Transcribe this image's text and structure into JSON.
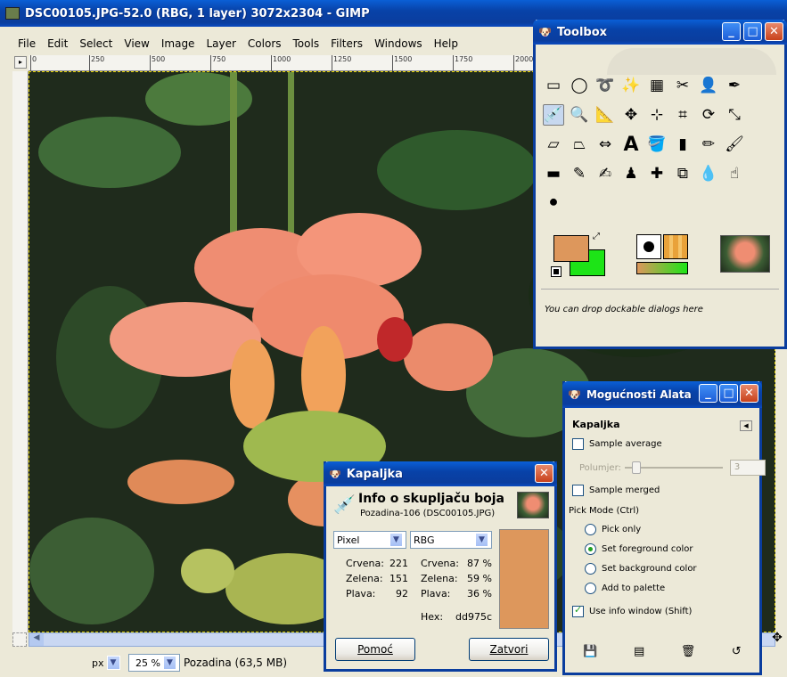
{
  "main_window": {
    "title": "DSC00105.JPG-52.0 (RBG, 1 layer) 3072x2304 - GIMP",
    "menu": [
      "File",
      "Edit",
      "Select",
      "View",
      "Image",
      "Layer",
      "Colors",
      "Tools",
      "Filters",
      "Windows",
      "Help"
    ],
    "ruler_marks": [
      "0",
      "250",
      "500",
      "750",
      "1000",
      "1250",
      "1500",
      "1750",
      "2000"
    ],
    "status": {
      "unit": "px",
      "zoom": "25 %",
      "layer_info": "Pozadina (63,5 MB)"
    }
  },
  "toolbox": {
    "title": "Toolbox",
    "drop_message": "You can drop dockable dialogs here",
    "foreground_color": "#dd975c",
    "background_color": "#1de417"
  },
  "color_picker_info": {
    "title": "Kapaljka",
    "heading": "Info o skupljaču boja",
    "subheading": "Pozadina-106 (DSC00105.JPG)",
    "left_mode": "Pixel",
    "right_mode": "RBG",
    "left_rows": [
      {
        "label": "Crvena:",
        "value": "221"
      },
      {
        "label": "Zelena:",
        "value": "151"
      },
      {
        "label": "Plava:",
        "value": "92"
      }
    ],
    "right_rows": [
      {
        "label": "Crvena:",
        "value": "87 %"
      },
      {
        "label": "Zelena:",
        "value": "59 %"
      },
      {
        "label": "Plava:",
        "value": "36 %"
      }
    ],
    "hex_label": "Hex:",
    "hex_value": "dd975c",
    "swatch_color": "#dd975c",
    "help_button": "Pomoć",
    "close_button": "Zatvori"
  },
  "tool_options": {
    "title": "Mogućnosti Alata",
    "tool_name": "Kapaljka",
    "sample_average": "Sample average",
    "radius_label": "Polumjer:",
    "radius_value": "3",
    "sample_merged": "Sample merged",
    "pick_mode_label": "Pick Mode  (Ctrl)",
    "pick_modes": [
      "Pick only",
      "Set foreground color",
      "Set background color",
      "Add to palette"
    ],
    "selected_pick_mode": "Set foreground color",
    "use_info_window": "Use info window  (Shift)"
  }
}
